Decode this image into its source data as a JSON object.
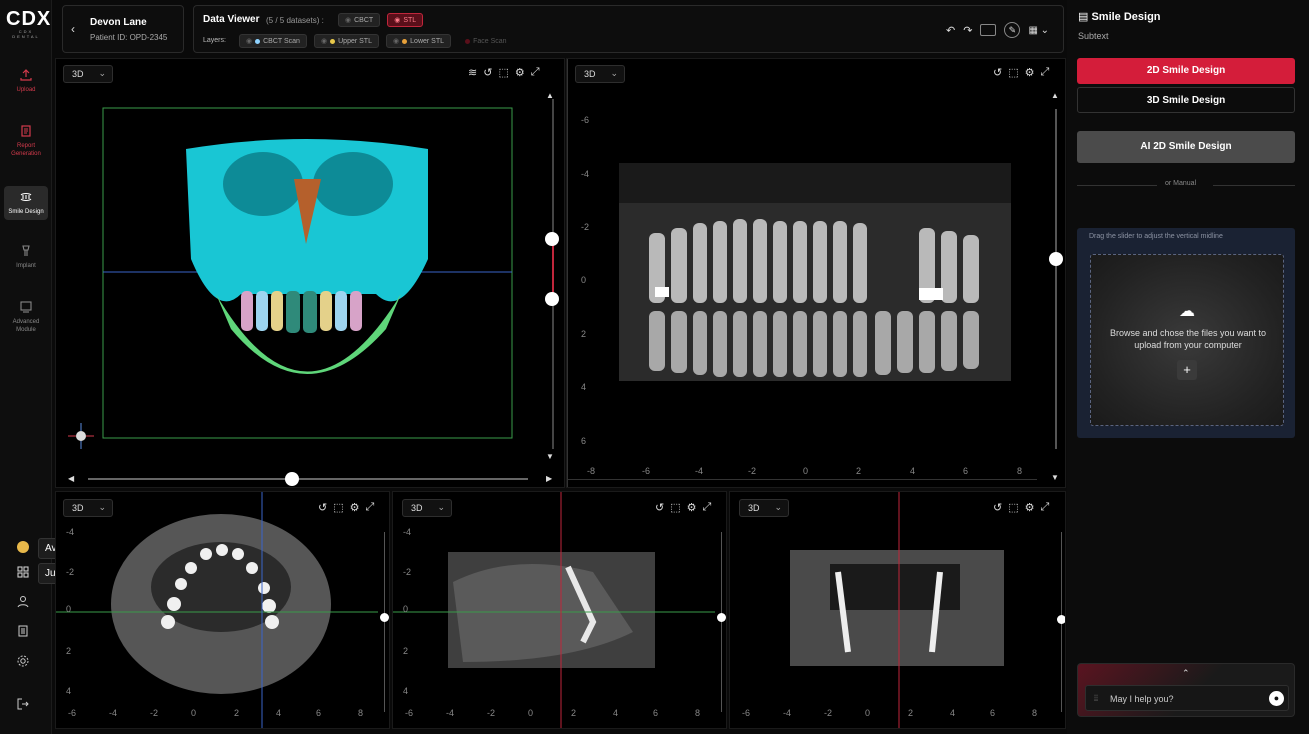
{
  "brand": {
    "mark": "CDX",
    "sub": "CDX DENTAL"
  },
  "rail": {
    "items": [
      {
        "label": "Upload",
        "icon": "upload-icon"
      },
      {
        "label": "Report Generation",
        "icon": "report-icon"
      },
      {
        "label": "Smile Design",
        "icon": "smile-design-icon"
      },
      {
        "label": "Implant",
        "icon": "implant-icon"
      },
      {
        "label": "Advanced Module",
        "icon": "advanced-module-icon"
      }
    ],
    "tooltips": {
      "credits": "Available Credits",
      "dashboard": "Jump to Dashboard"
    }
  },
  "patient": {
    "name": "Devon Lane",
    "id": "Patient ID: OPD-2345"
  },
  "viewer": {
    "title": "Data Viewer",
    "count": "(5 / 5 datasets) :",
    "chips": [
      "CBCT",
      "STL"
    ],
    "layers_label": "Layers:",
    "layers": [
      {
        "label": "CBCT Scan",
        "color": "#8fd3ff"
      },
      {
        "label": "Upper STL",
        "color": "#e8c84a"
      },
      {
        "label": "Lower STL",
        "color": "#e8a13a"
      },
      {
        "label": "Face Scan",
        "color": "#c0263b"
      }
    ]
  },
  "views": {
    "v1": {
      "mode": "3D"
    },
    "v2": {
      "mode": "3D",
      "yticks": [
        "-6",
        "-4",
        "-2",
        "0",
        "2",
        "4",
        "6"
      ],
      "xticks": [
        "-8",
        "-6",
        "-4",
        "-2",
        "0",
        "2",
        "4",
        "6",
        "8"
      ]
    },
    "v3": {
      "mode": "3D",
      "yticks": [
        "-4",
        "-2",
        "0",
        "2",
        "4"
      ],
      "xticks": [
        "-6",
        "-4",
        "-2",
        "0",
        "2",
        "4",
        "6",
        "8"
      ]
    },
    "v4": {
      "mode": "3D",
      "yticks": [
        "-4",
        "-2",
        "0",
        "2",
        "4"
      ],
      "xticks": [
        "-6",
        "-4",
        "-2",
        "0",
        "2",
        "4",
        "6",
        "8"
      ]
    },
    "v5": {
      "mode": "3D",
      "yticks": [
        "-4",
        "-2",
        "0",
        "2",
        "4"
      ],
      "xticks": [
        "-6",
        "-4",
        "-2",
        "0",
        "2",
        "4",
        "6",
        "8"
      ]
    }
  },
  "panel": {
    "title": "Smile Design",
    "subtext": "Subtext",
    "btn_2d": "2D Smile Design",
    "btn_3d": "3D Smile Design",
    "btn_ai": "AI 2D Smile Design",
    "or_manual": "or Manual",
    "hint": "Drag the slider to adjust the vertical midline",
    "upload_text": "Browse and chose the files you want to upload from your computer",
    "chat_placeholder": "May I help you?"
  }
}
